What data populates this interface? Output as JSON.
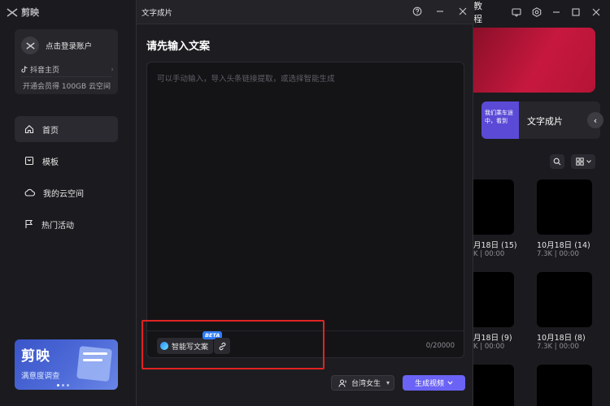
{
  "app": {
    "logo_text": "剪映",
    "tutorial_label": "教程"
  },
  "account": {
    "login_label": "点击登录账户",
    "douyin_label": "抖音主页",
    "vip_label": "开通会员得 100GB 云空间"
  },
  "nav": {
    "items": [
      {
        "label": "首页",
        "icon": "home-icon",
        "active": true
      },
      {
        "label": "模板",
        "icon": "template-icon",
        "active": false
      },
      {
        "label": "我的云空间",
        "icon": "cloud-icon",
        "active": false
      },
      {
        "label": "热门活动",
        "icon": "flag-icon",
        "active": false
      }
    ]
  },
  "banner": {
    "title": "剪映",
    "subtitle": "满意度调查"
  },
  "feature": {
    "thumb_text": "我们乘车途中，看到",
    "label": "文字成片"
  },
  "grid": {
    "cells": [
      {
        "title": "月18日 (15)",
        "meta": "K | 00:00"
      },
      {
        "title": "10月18日 (14)",
        "meta": "7.3K | 00:00"
      },
      {
        "title": "月18日 (9)",
        "meta": "K | 00:00"
      },
      {
        "title": "10月18日 (8)",
        "meta": "7.3K | 00:00"
      }
    ]
  },
  "modal": {
    "window_title": "文字成片",
    "prompt": "请先输入文案",
    "placeholder": "可以手动输入，导入头条链接提取，或选择智能生成",
    "ai_write_label": "智能写文案",
    "beta_label": "BETA",
    "counter": "0/20000",
    "voice_label": "台湾女生",
    "generate_label": "生成视频"
  },
  "colors": {
    "accent": "#6b63f5",
    "highlight": "#e02323",
    "hero": "#c7183f"
  }
}
